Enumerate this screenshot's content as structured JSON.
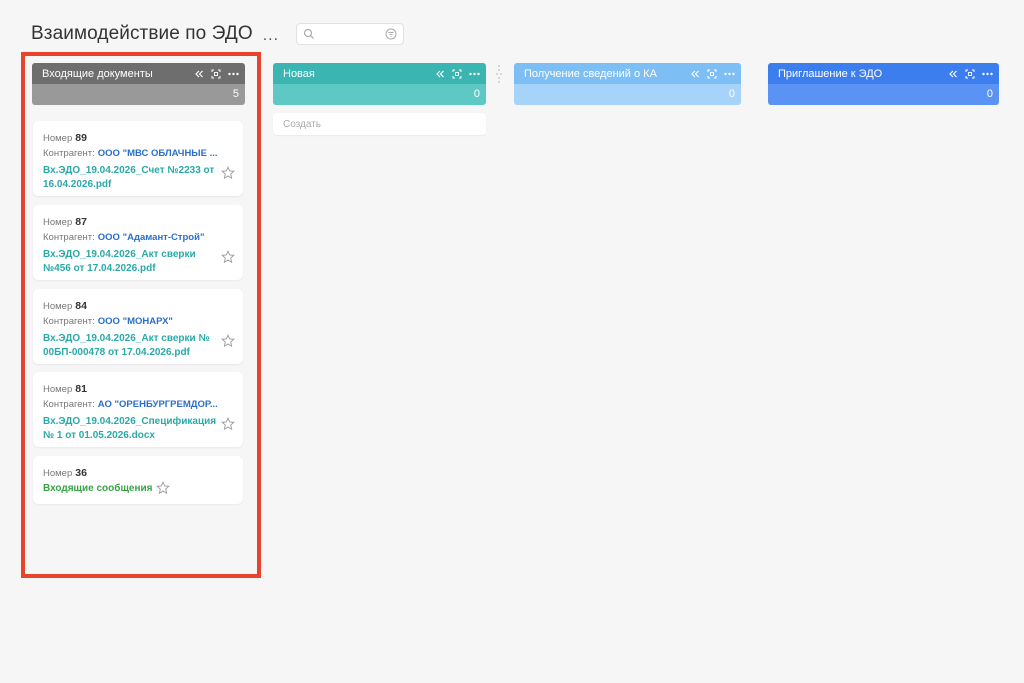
{
  "page": {
    "title": "Взаимодействие по ЭДО",
    "more_label": "..."
  },
  "search": {
    "value": "",
    "placeholder": ""
  },
  "columns": [
    {
      "title": "Входящие документы",
      "count": "5",
      "head_color": "#6e6e6e",
      "count_color": "#999999"
    },
    {
      "title": "Новая",
      "count": "0",
      "head_color": "#3ab5b2",
      "count_color": "#5ec8c4",
      "create_label": "Создать"
    },
    {
      "title": "Получение сведений о КА",
      "count": "0",
      "head_color": "#7dbff5",
      "count_color": "#a6d3fa"
    },
    {
      "title": "Приглашение к ЭДО",
      "count": "0",
      "head_color": "#3d7eef",
      "count_color": "#5a93f3"
    }
  ],
  "cards": [
    {
      "number_label": "Номер",
      "number": "89",
      "party_label": "Контрагент:",
      "party": "ООО \"МВС ОБЛАЧНЫЕ ...",
      "file": "Вх.ЭДО_19.04.2026_Счет №2233 от 16.04.2026.pdf"
    },
    {
      "number_label": "Номер",
      "number": "87",
      "party_label": "Контрагент:",
      "party": "ООО \"Адамант-Строй\"",
      "file": "Вх.ЭДО_19.04.2026_Акт сверки №456 от 17.04.2026.pdf"
    },
    {
      "number_label": "Номер",
      "number": "84",
      "party_label": "Контрагент:",
      "party": "ООО \"МОНАРХ\"",
      "file": "Вх.ЭДО_19.04.2026_Акт сверки № 00БП-000478 от 17.04.2026.pdf"
    },
    {
      "number_label": "Номер",
      "number": "81",
      "party_label": "Контрагент:",
      "party": "АО \"ОРЕНБУРГРЕМДОР...",
      "file": "Вх.ЭДО_19.04.2026_Спецификация № 1 от 01.05.2026.docx"
    },
    {
      "number_label": "Номер",
      "number": "36",
      "message": "Входящие сообщения"
    }
  ],
  "icons": {
    "collapse": "chevrons-left-icon",
    "focus": "focus-frame-icon",
    "more": "more-dots-icon",
    "star": "star-outline-icon",
    "search": "search-icon",
    "filter": "filter-icon"
  }
}
